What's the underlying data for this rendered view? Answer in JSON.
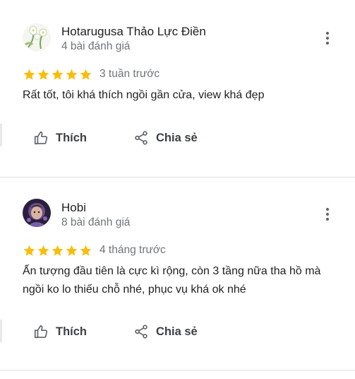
{
  "reviews": [
    {
      "name": "Hotarugusa Thảo Lực Điền",
      "review_count": "4 bài đánh giá",
      "rating": 5,
      "time": "3 tuần trước",
      "text": "Rất tốt, tôi khá thích ngồi gần cửa, view khá đẹp",
      "like_label": "Thích",
      "share_label": "Chia sẻ"
    },
    {
      "name": "Hobi",
      "review_count": "8 bài đánh giá",
      "rating": 5,
      "time": "4 tháng trước",
      "text": "Ấn tượng đầu tiên là cực kì rộng, còn 3 tầng nữa tha hồ mà ngồi ko lo thiếu chỗ nhé, phục vụ khá ok nhé",
      "like_label": "Thích",
      "share_label": "Chia sẻ"
    }
  ],
  "colors": {
    "star": "#fbbc04",
    "secondary_text": "#70757a",
    "divider": "#e3e3e3"
  },
  "icons": {
    "more": "more-vert-icon",
    "like": "thumb-up-icon",
    "share": "share-icon"
  }
}
